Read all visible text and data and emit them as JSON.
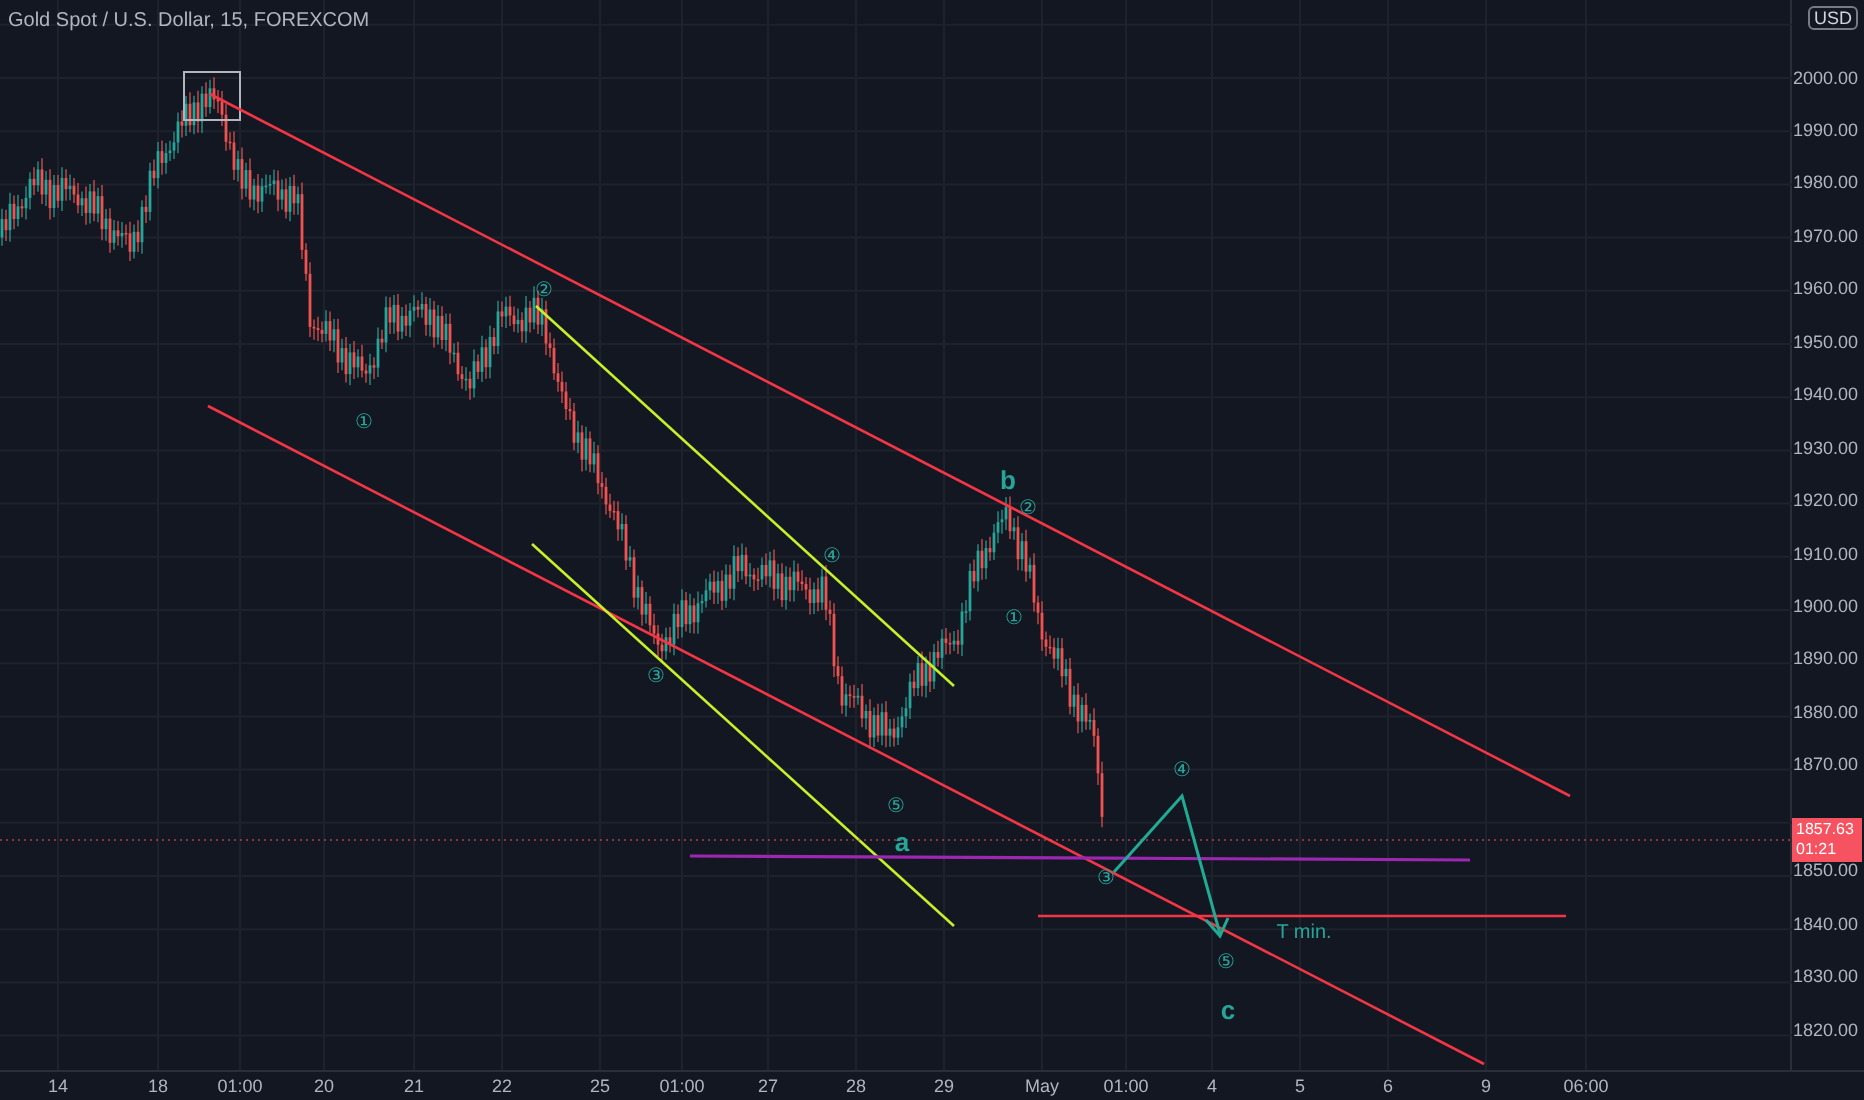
{
  "chart": {
    "title": "Gold Spot / U.S. Dollar, 15, FOREXCOM",
    "wave_labels": [
      {
        "text": "①"
      },
      {
        "text": "②"
      },
      {
        "text": "③"
      },
      {
        "text": "④"
      },
      {
        "text": "⑤"
      },
      {
        "text": "a"
      },
      {
        "text": "b"
      },
      {
        "text": "②"
      },
      {
        "text": "①"
      },
      {
        "text": "③"
      },
      {
        "text": "④"
      },
      {
        "text": "⑤"
      },
      {
        "text": "c"
      },
      {
        "text": "T min."
      }
    ]
  },
  "price_axis": {
    "currency": "USD",
    "labels_above": [
      "2000.00",
      "1990.00",
      "1980.00",
      "1970.00",
      "1960.00",
      "1950.00",
      "1940.00",
      "1930.00",
      "1920.00",
      "1910.00",
      "1900.00",
      "1890.00",
      "1880.00",
      "1870.00"
    ],
    "last_price": {
      "value": "1857.63",
      "countdown": "01:21"
    },
    "labels_below": [
      "1850.00",
      "1840.00",
      "1830.00",
      "1820.00"
    ]
  },
  "time_axis": {
    "labels": [
      "14",
      "18",
      "01:00",
      "20",
      "21",
      "22",
      "25",
      "01:00",
      "27",
      "28",
      "29",
      "May",
      "01:00",
      "4",
      "5",
      "6",
      "9",
      "06:00"
    ]
  }
}
